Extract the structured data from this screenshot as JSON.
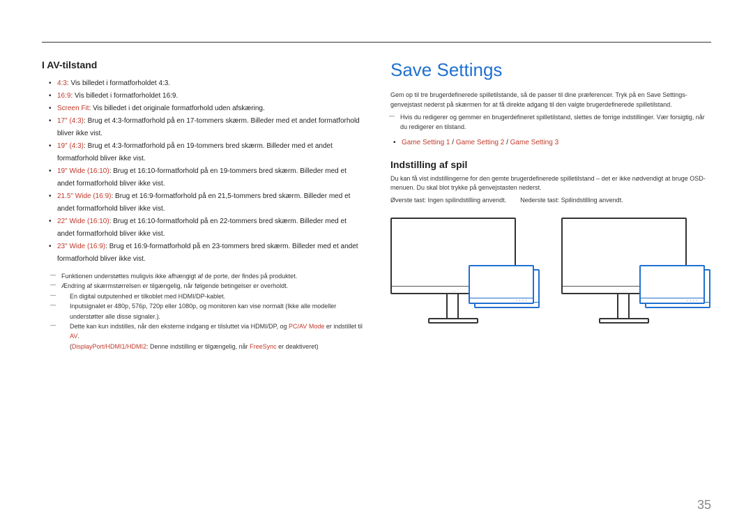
{
  "left": {
    "heading": "I AV-tilstand",
    "items": [
      {
        "opt": "4:3",
        "tail": ": Vis billedet i formatforholdet 4:3."
      },
      {
        "opt": "16:9",
        "tail": ": Vis billedet i formatforholdet 16:9."
      },
      {
        "opt": "Screen Fit",
        "tail": ": Vis billedet i det originale formatforhold uden afskæring."
      },
      {
        "opt": "17\" (4:3)",
        "tail": ": Brug et 4:3-formatforhold på en 17-tommers skærm. Billeder med et andet formatforhold bliver ikke vist."
      },
      {
        "opt": "19\" (4:3)",
        "tail": ": Brug et 4:3-formatforhold på en 19-tommers bred skærm. Billeder med et andet formatforhold bliver ikke vist."
      },
      {
        "opt": "19\" Wide (16:10)",
        "tail": ": Brug et 16:10-formatforhold på en 19-tommers bred skærm. Billeder med et andet formatforhold bliver ikke vist."
      },
      {
        "opt": "21.5\" Wide (16:9)",
        "tail": ": Brug et 16:9-formatforhold på en 21,5-tommers bred skærm. Billeder med et andet formatforhold bliver ikke vist."
      },
      {
        "opt": "22\" Wide (16:10)",
        "tail": ": Brug et 16:10-formatforhold på en 22-tommers bred skærm. Billeder med et andet formatforhold bliver ikke vist."
      },
      {
        "opt": "23\" Wide (16:9)",
        "tail": ": Brug et 16:9-formatforhold på en 23-tommers bred skærm. Billeder med et andet formatforhold bliver ikke vist."
      }
    ],
    "notes": {
      "n1": "Funktionen understøttes muligvis ikke afhængigt af de porte, der findes på produktet.",
      "n2": "Ændring af skærmstørrelsen er tilgængelig, når følgende betingelser er overholdt.",
      "n3": "En digital outputenhed er tilkoblet med HDMI/DP-kablet.",
      "n4": "Inputsignalet er 480p, 576p, 720p eller 1080p, og monitoren kan vise normalt (Ikke alle modeller understøtter alle disse signaler.).",
      "n5a": "Dette kan kun indstilles, når den eksterne indgang er tilsluttet via HDMI/DP, og ",
      "n5_opt": "PC/AV Mode",
      "n5b": " er indstillet til ",
      "n5_opt2": "AV",
      "n5c": ".",
      "n6a": "(",
      "n6_ports": "DisplayPort/HDMI1/HDMI2",
      "n6b": ": Denne indstilling er tilgængelig, når ",
      "n6_opt": "FreeSync",
      "n6c": " er deaktiveret)"
    }
  },
  "right": {
    "title": "Save Settings",
    "intro1": "Gem op til tre brugerdefinerede spilletilstande, så de passer til dine præferencer. Tryk på en Save Settings-genvejstast nederst på skærmen for at få direkte adgang til den valgte brugerdefinerede spilletilstand.",
    "intro2": "Hvis du redigerer og gemmer en brugerdefineret spilletilstand, slettes de forrige indstillinger. Vær forsigtig, når du redigerer en tilstand.",
    "settings_line": {
      "a": "Game Setting 1",
      "b": "Game Setting 2",
      "c": "Game Setting 3",
      "sep": " / "
    },
    "sub": "Indstilling af spil",
    "body1": "Du kan få vist indstillingerne for den gemte brugerdefinerede spilletilstand – det er ikke nødvendigt at bruge OSD-menuen. Du skal blot trykke på genvejstasten nederst.",
    "body2a": "Øverste tast: Ingen spilindstilling anvendt.",
    "body2b": "Nederste tast: Spilindstilling anvendt."
  },
  "page": "35"
}
